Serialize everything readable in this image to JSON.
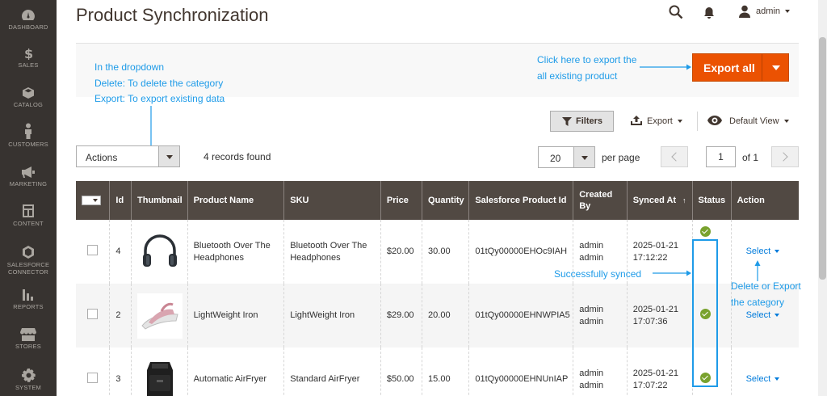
{
  "sidebar": {
    "items": [
      {
        "label": "DASHBOARD",
        "icon": "dashboard-icon"
      },
      {
        "label": "SALES",
        "icon": "dollar-icon"
      },
      {
        "label": "CATALOG",
        "icon": "cube-icon"
      },
      {
        "label": "CUSTOMERS",
        "icon": "person-icon"
      },
      {
        "label": "MARKETING",
        "icon": "megaphone-icon"
      },
      {
        "label": "CONTENT",
        "icon": "layout-icon"
      },
      {
        "label": "SALESFORCE",
        "label2": "CONNECTOR",
        "icon": "hexagon-icon"
      },
      {
        "label": "REPORTS",
        "icon": "bar-chart-icon"
      },
      {
        "label": "STORES",
        "icon": "store-icon"
      },
      {
        "label": "SYSTEM",
        "icon": "gear-icon"
      }
    ]
  },
  "header": {
    "title": "Product Synchronization",
    "user": "admin"
  },
  "annotations": {
    "dropdown_line1": "In the dropdown",
    "dropdown_line2": "Delete: To delete the category",
    "dropdown_line3": "Export: To export existing data",
    "export_line1": "Click here to export the",
    "export_line2": "all existing product",
    "synced": "Successfully synced",
    "action_line1": "Delete or Export",
    "action_line2": "the category"
  },
  "toolbar": {
    "export_all": "Export all",
    "filters": "Filters",
    "export": "Export",
    "default_view": "Default View",
    "actions": "Actions",
    "records_found": "4 records found",
    "page_size": "20",
    "per_page": "per page",
    "current_page": "1",
    "of_pages": "of 1"
  },
  "table": {
    "columns": [
      "Id",
      "Thumbnail",
      "Product Name",
      "SKU",
      "Price",
      "Quantity",
      "Salesforce Product Id",
      "Created By",
      "Synced At",
      "Status",
      "Action"
    ],
    "sort_indicator": "↑",
    "rows": [
      {
        "id": "4",
        "name": "Bluetooth Over The Headphones",
        "sku": "Bluetooth Over The Headphones",
        "price": "$20.00",
        "qty": "30.00",
        "sfid": "01tQy00000EHOc9IAH",
        "created1": "admin",
        "created2": "admin",
        "synced1": "2025-01-21",
        "synced2": "17:12:22",
        "action": "Select"
      },
      {
        "id": "2",
        "name": "LightWeight Iron",
        "sku": "LightWeight Iron",
        "price": "$29.00",
        "qty": "20.00",
        "sfid": "01tQy00000EHNWPIA5",
        "created1": "admin",
        "created2": "admin",
        "synced1": "2025-01-21",
        "synced2": "17:07:36",
        "action": "Select"
      },
      {
        "id": "3",
        "name": "Automatic AirFryer",
        "sku": "Standard AirFryer",
        "price": "$50.00",
        "qty": "15.00",
        "sfid": "01tQy00000EHNUnIAP",
        "created1": "admin",
        "created2": "admin",
        "synced1": "2025-01-21",
        "synced2": "17:07:22",
        "action": "Select"
      }
    ]
  },
  "colors": {
    "sidebar": "#373330",
    "accent": "#eb5202",
    "header_row": "#514943",
    "link": "#007bdb",
    "annotation": "#1e9be8",
    "success": "#79a22e"
  }
}
